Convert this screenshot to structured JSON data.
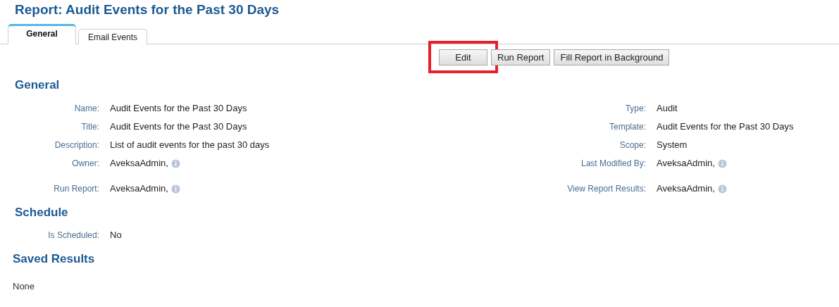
{
  "page_title": "Report: Audit Events for the Past 30 Days",
  "tabs": [
    {
      "label": "General",
      "selected": true
    },
    {
      "label": "Email Events",
      "selected": false
    }
  ],
  "actions": [
    {
      "label": "Edit",
      "highlighted": true
    },
    {
      "label": "Run Report",
      "highlighted": false
    },
    {
      "label": "Fill Report in Background",
      "highlighted": false
    }
  ],
  "general": {
    "heading": "General",
    "rows": [
      {
        "left": {
          "label": "Name:",
          "value": "Audit Events for the Past 30 Days"
        },
        "right": {
          "label": "Type:",
          "value": "Audit"
        }
      },
      {
        "left": {
          "label": "Title:",
          "value": "Audit Events for the Past 30 Days"
        },
        "right": {
          "label": "Template:",
          "value": "Audit Events for the Past 30 Days"
        }
      },
      {
        "left": {
          "label": "Description:",
          "value": "List of audit events for the past 30 days"
        },
        "right": {
          "label": "Scope:",
          "value": "System"
        }
      },
      {
        "left": {
          "label": "Owner:",
          "value": "AveksaAdmin,",
          "info": true
        },
        "right": {
          "label": "Last Modified By:",
          "value": "AveksaAdmin,",
          "info": true
        }
      },
      {
        "left": {
          "label": "Run Report:",
          "value": "AveksaAdmin,",
          "info": true
        },
        "right": {
          "label": "View Report Results:",
          "value": "AveksaAdmin,",
          "info": true
        }
      }
    ]
  },
  "schedule": {
    "heading": "Schedule",
    "rows": [
      {
        "label": "Is Scheduled:",
        "value": "No"
      }
    ]
  },
  "saved_results": {
    "heading": "Saved Results",
    "text": "None"
  }
}
